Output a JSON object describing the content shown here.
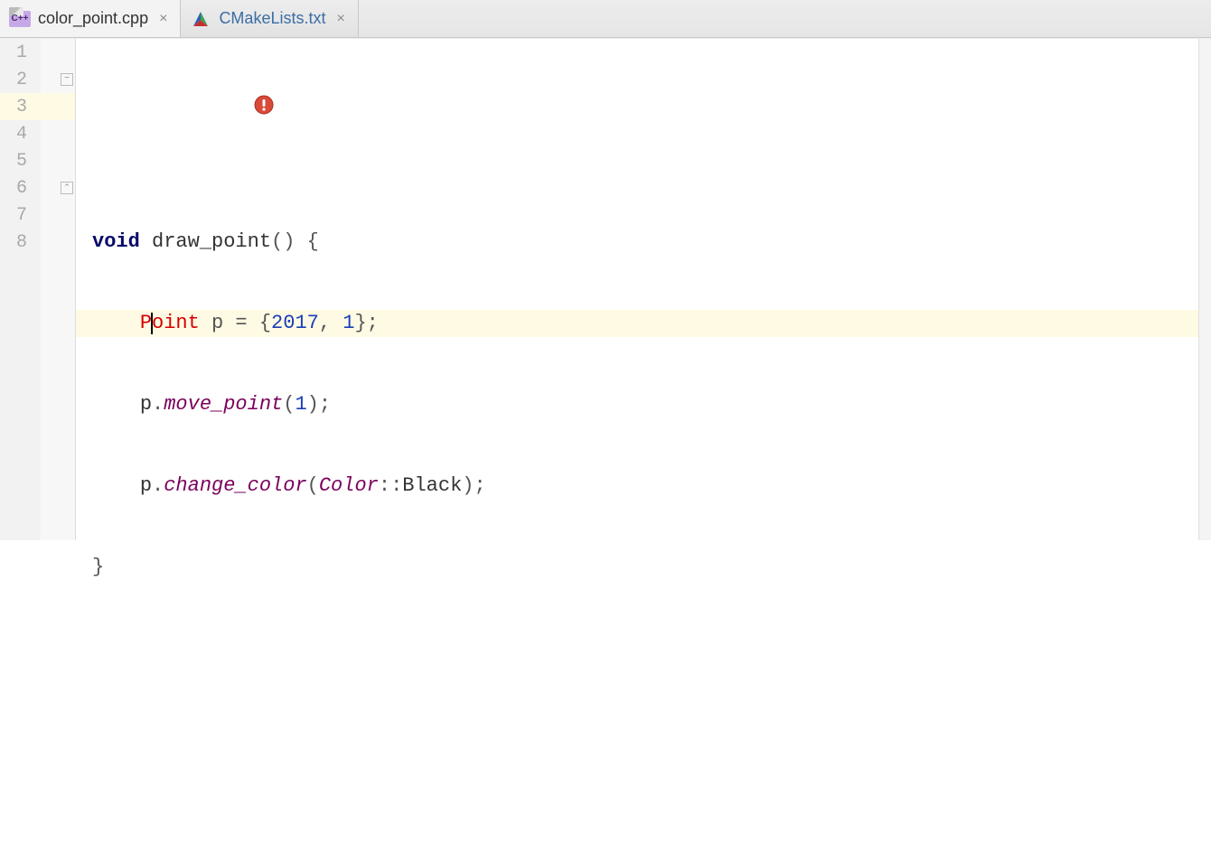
{
  "tabs": [
    {
      "label": "color_point.cpp",
      "active": true,
      "iconName": "cpp-file-icon"
    },
    {
      "label": "CMakeLists.txt",
      "active": false,
      "iconName": "cmake-file-icon"
    }
  ],
  "closeGlyph": "×",
  "gutter": {
    "lines": [
      "1",
      "2",
      "3",
      "4",
      "5",
      "6",
      "7",
      "8"
    ],
    "foldStartLine": 2,
    "foldEndLine": 6,
    "errorBadgeLine": 2,
    "highlightedLine": 3
  },
  "code": {
    "line2": {
      "indent": "",
      "kw_void": "void",
      "space1": " ",
      "fname": "draw_point",
      "parens_open": "()",
      "space2": " ",
      "brace": "{"
    },
    "line3": {
      "indent": "    ",
      "err_P": "P",
      "err_oint": "oint",
      "rest1": " p = {",
      "num1": "2017",
      "comma": ", ",
      "num2": "1",
      "rest2": "};"
    },
    "line4": {
      "indent": "    ",
      "obj": "p",
      "dot": ".",
      "method": "move_point",
      "args_open": "(",
      "num": "1",
      "args_close": ");"
    },
    "line5": {
      "indent": "    ",
      "obj": "p",
      "dot": ".",
      "method": "change_color",
      "args_open": "(",
      "enum": "Color",
      "scope": "::",
      "enumval": "Black",
      "args_close": ");"
    },
    "line6": {
      "brace": "}"
    }
  },
  "foldGlyph": {
    "minus": "−",
    "end": "⌃"
  },
  "cppBadge": "C++"
}
